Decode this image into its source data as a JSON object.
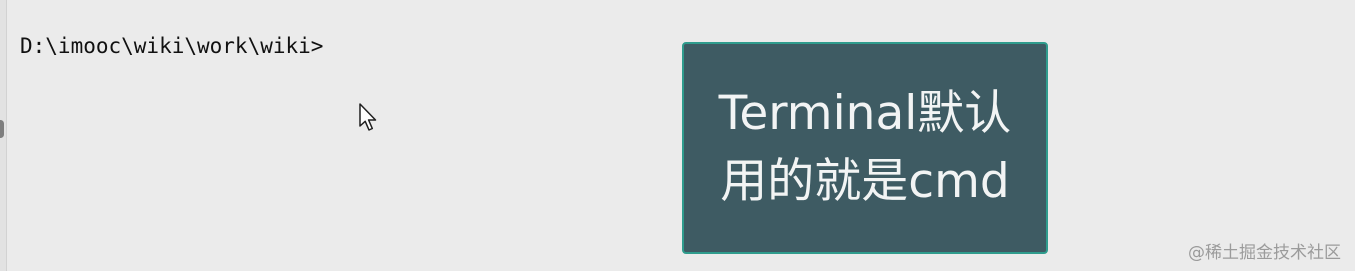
{
  "terminal": {
    "prompt": "D:\\imooc\\wiki\\work\\wiki>"
  },
  "callout": {
    "line1": "Terminal默认",
    "line2": "用的就是cmd"
  },
  "watermark": {
    "text": "@稀土掘金技术社区"
  },
  "colors": {
    "background": "#ebebeb",
    "callout_bg": "#3e5b63",
    "callout_border": "#2f9c8d",
    "callout_text": "#f2f4f4"
  },
  "icons": {
    "cursor": "mouse-pointer-icon"
  }
}
